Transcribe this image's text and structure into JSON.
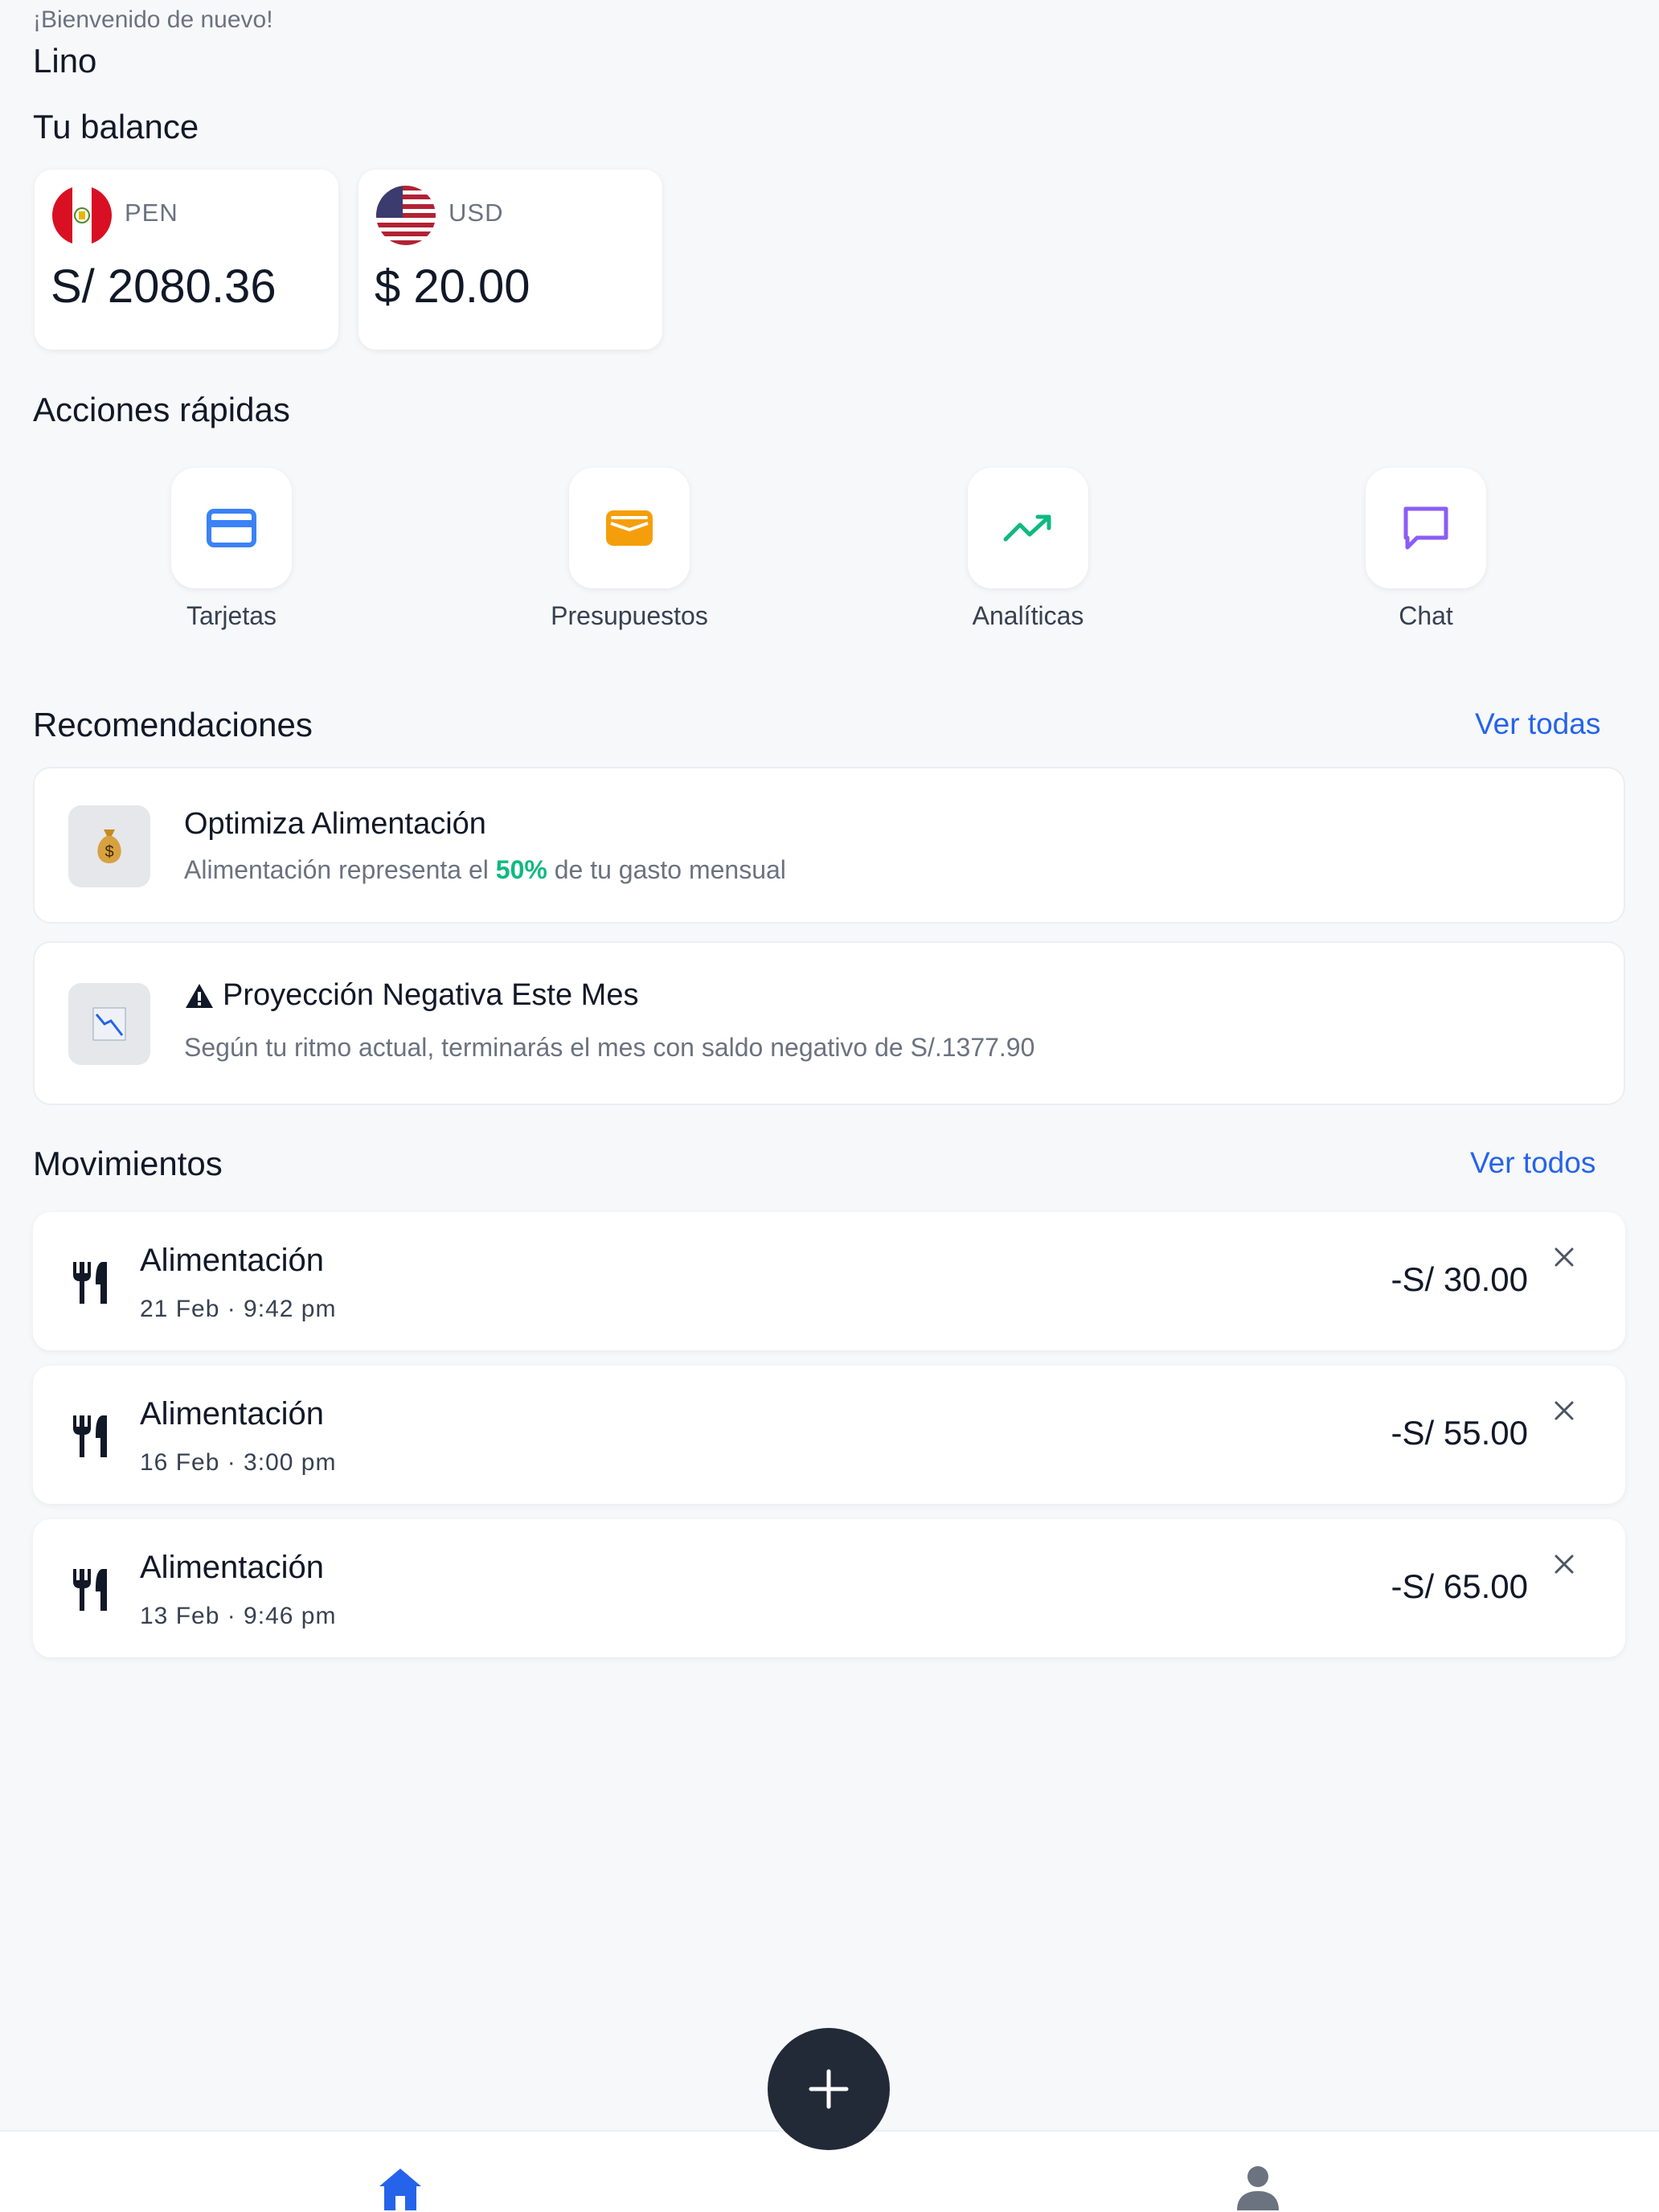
{
  "header": {
    "greeting": "¡Bienvenido de nuevo!",
    "username": "Lino"
  },
  "balance": {
    "title": "Tu balance",
    "accounts": [
      {
        "currency": "PEN",
        "amount": "S/ 2080.36",
        "flag": "peru-flag-icon"
      },
      {
        "currency": "USD",
        "amount": "$ 20.00",
        "flag": "usa-flag-icon"
      }
    ]
  },
  "quick_actions": {
    "title": "Acciones rápidas",
    "items": [
      {
        "label": "Tarjetas",
        "icon": "credit-card-icon",
        "color": "#3b82f6"
      },
      {
        "label": "Presupuestos",
        "icon": "wallet-icon",
        "color": "#f59e0b"
      },
      {
        "label": "Analíticas",
        "icon": "trending-up-icon",
        "color": "#10b981"
      },
      {
        "label": "Chat",
        "icon": "chat-icon",
        "color": "#8b5cf6"
      }
    ]
  },
  "recommendations": {
    "title": "Recomendaciones",
    "see_all": "Ver todas",
    "items": [
      {
        "icon": "money-bag-icon",
        "title": "Optimiza Alimentación",
        "desc_before": "Alimentación representa el ",
        "desc_highlight": "50%",
        "desc_after": " de tu gasto mensual"
      },
      {
        "icon": "chart-decreasing-icon",
        "title_icon": "warning-icon",
        "title": "Proyección Negativa Este Mes",
        "desc": "Según tu ritmo actual, terminarás el mes con saldo negativo de S/.1377.90"
      }
    ]
  },
  "movements": {
    "title": "Movimientos",
    "see_all": "Ver todos",
    "items": [
      {
        "category": "Alimentación",
        "date": "21 Feb · 9:42 pm",
        "amount": "-S/ 30.00",
        "icon": "utensils-icon"
      },
      {
        "category": "Alimentación",
        "date": "16 Feb · 3:00 pm",
        "amount": "-S/ 55.00",
        "icon": "utensils-icon"
      },
      {
        "category": "Alimentación",
        "date": "13 Feb · 9:46 pm",
        "amount": "-S/ 65.00",
        "icon": "utensils-icon"
      }
    ]
  },
  "fab": {
    "icon": "plus-icon"
  },
  "bottom_nav": {
    "items": [
      {
        "icon": "home-icon",
        "active": true,
        "color": "#2563eb"
      },
      {
        "icon": "user-icon",
        "active": false,
        "color": "#6b7280"
      }
    ]
  },
  "colors": {
    "accent": "#2563eb",
    "positive": "#10b981",
    "background": "#f7f8fa"
  }
}
